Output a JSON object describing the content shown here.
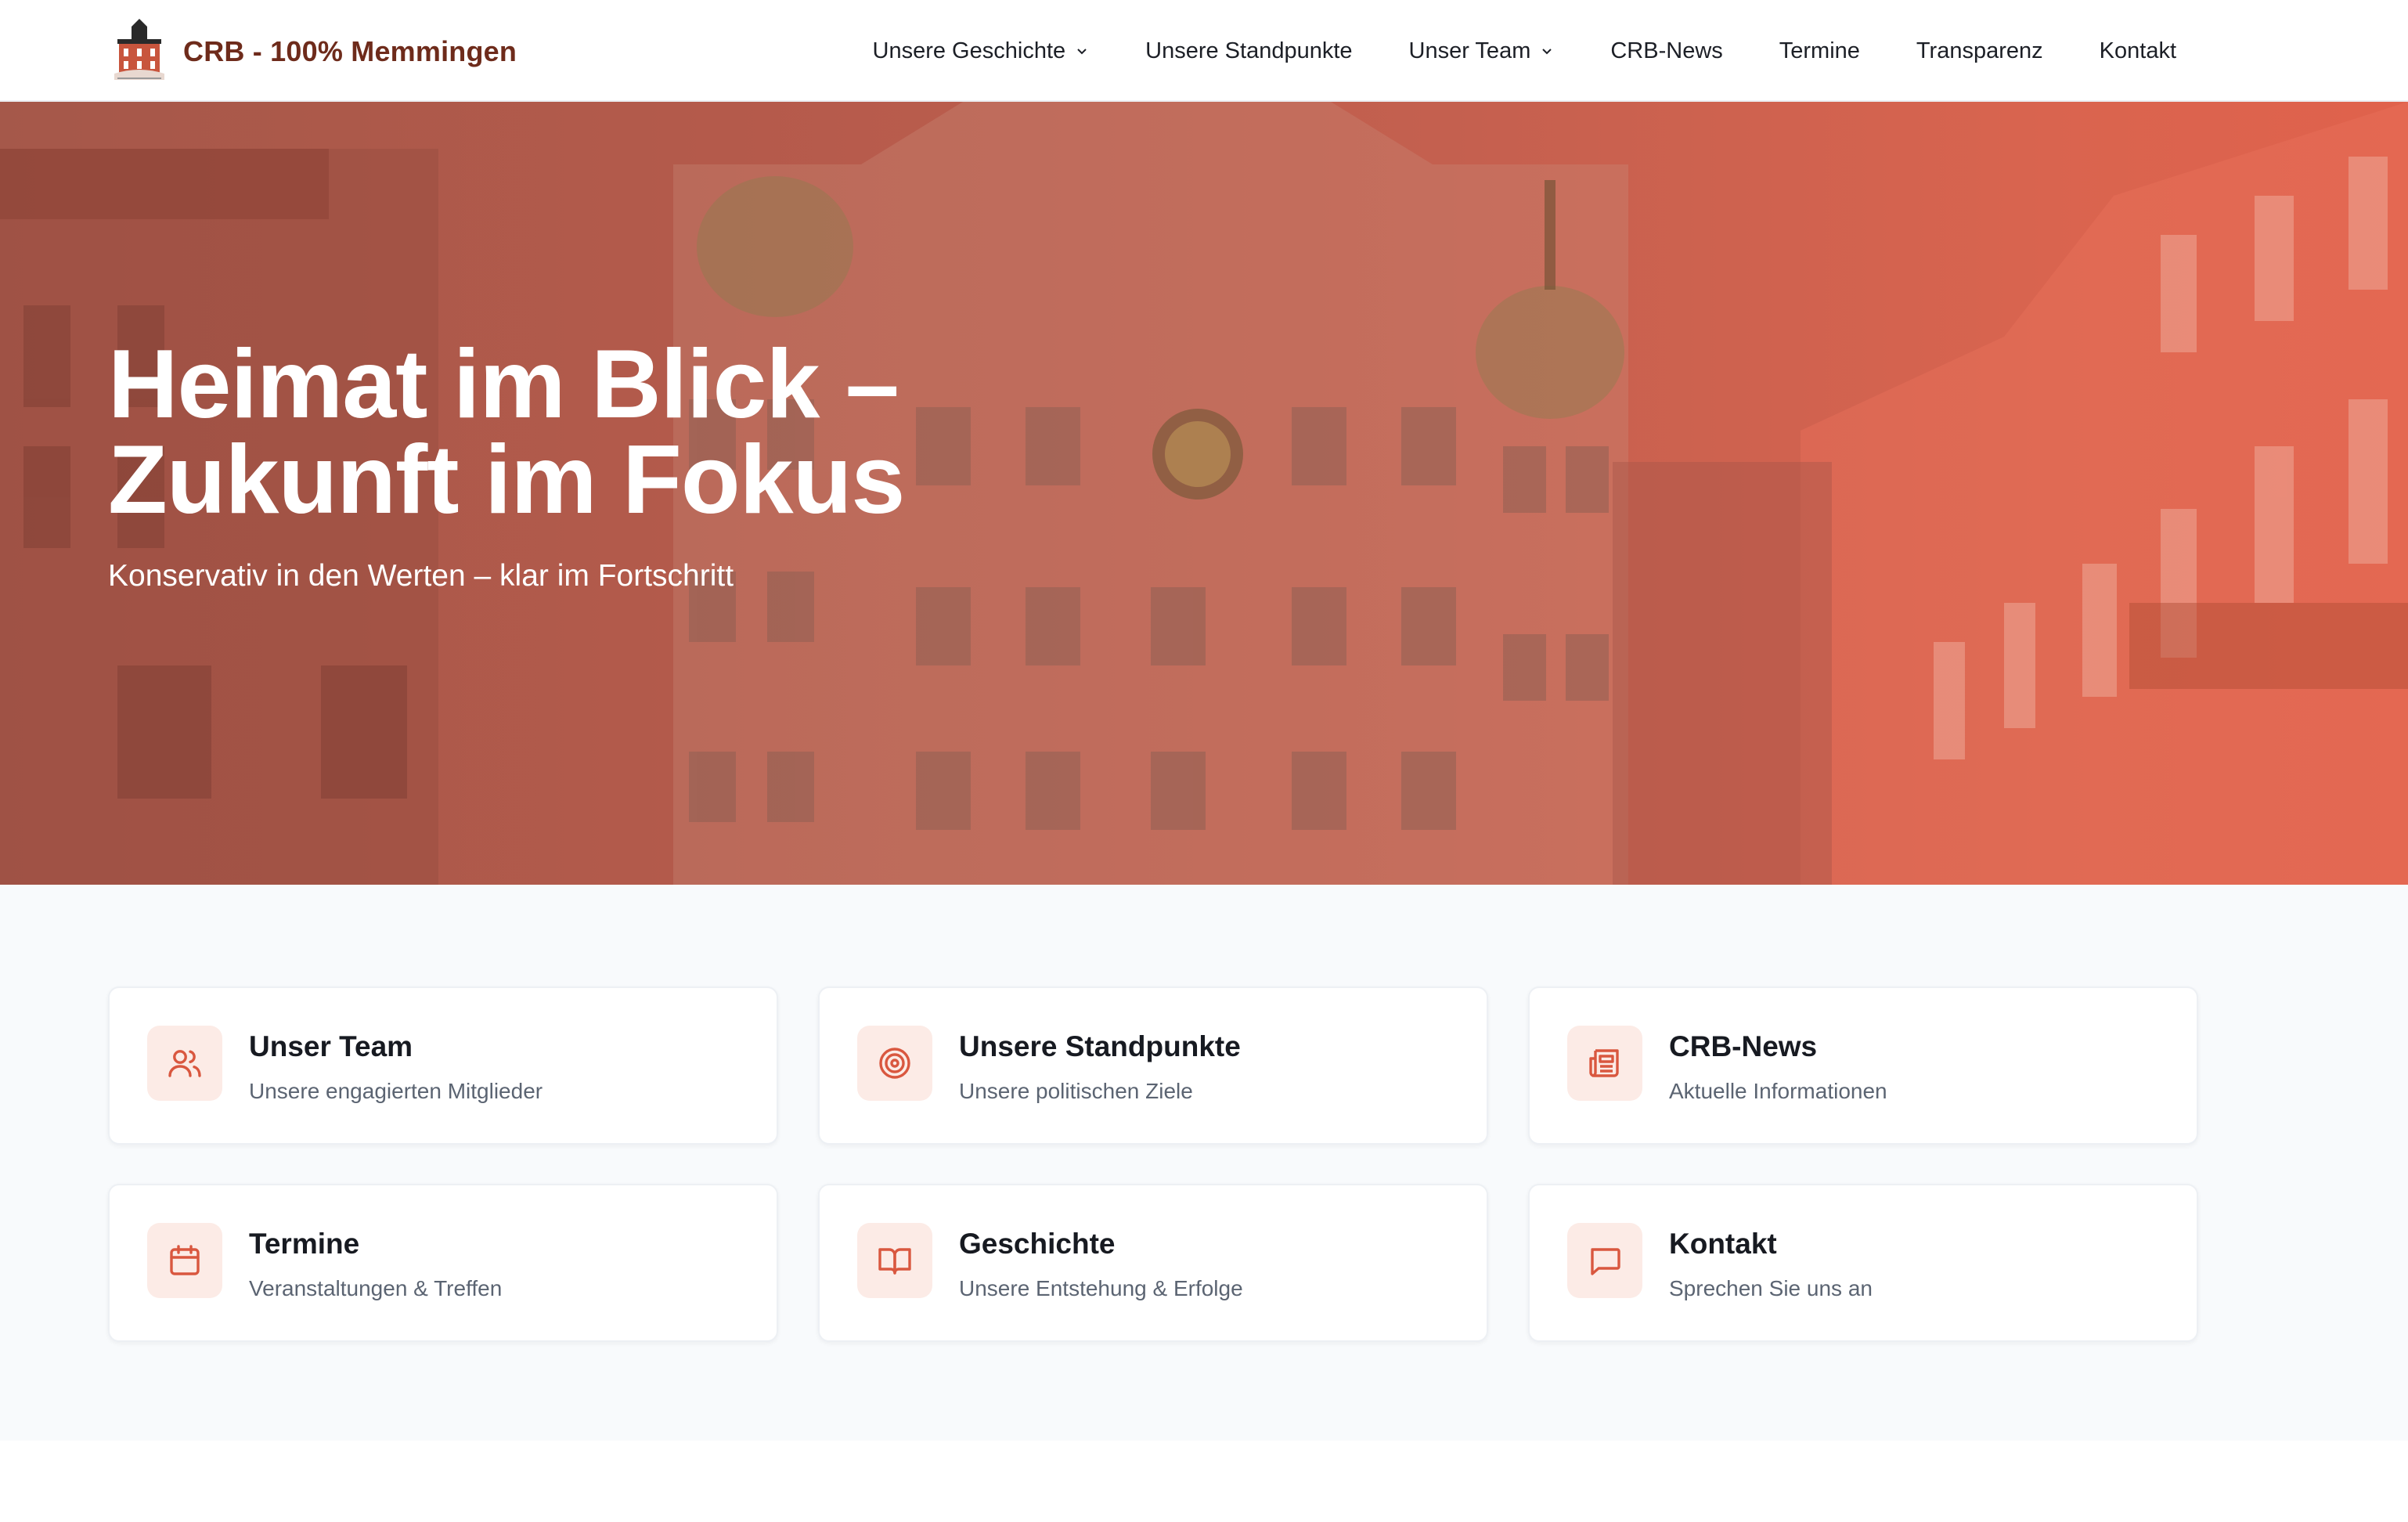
{
  "brand": {
    "name": "CRB - 100% Memmingen",
    "logo": "town-hall-logo"
  },
  "nav": {
    "items": [
      {
        "label": "Unsere Geschichte",
        "dropdown": true
      },
      {
        "label": "Unsere Standpunkte",
        "dropdown": false
      },
      {
        "label": "Unser Team",
        "dropdown": true
      },
      {
        "label": "CRB-News",
        "dropdown": false
      },
      {
        "label": "Termine",
        "dropdown": false
      },
      {
        "label": "Transparenz",
        "dropdown": false
      },
      {
        "label": "Kontakt",
        "dropdown": false
      }
    ]
  },
  "hero": {
    "title_line1": "Heimat im Blick –",
    "title_line2": "Zukunft im Fokus",
    "subtitle": "Konservativ in den Werten – klar im Fortschritt",
    "background": "historic-town-hall-photo"
  },
  "cards": [
    {
      "title": "Unser Team",
      "subtitle": "Unsere engagierten Mitglieder",
      "icon": "users-icon"
    },
    {
      "title": "Unsere Standpunkte",
      "subtitle": "Unsere politischen Ziele",
      "icon": "target-icon"
    },
    {
      "title": "CRB-News",
      "subtitle": "Aktuelle Informationen",
      "icon": "newspaper-icon"
    },
    {
      "title": "Termine",
      "subtitle": "Veranstaltungen & Treffen",
      "icon": "calendar-icon"
    },
    {
      "title": "Geschichte",
      "subtitle": "Unsere Entstehung & Erfolge",
      "icon": "book-icon"
    },
    {
      "title": "Kontakt",
      "subtitle": "Sprechen Sie uns an",
      "icon": "message-icon"
    }
  ],
  "colors": {
    "accent": "#d9573f",
    "brand_text": "#6e2b1b",
    "icon_bg": "#fcebe6",
    "section_bg": "#f8fafc"
  }
}
